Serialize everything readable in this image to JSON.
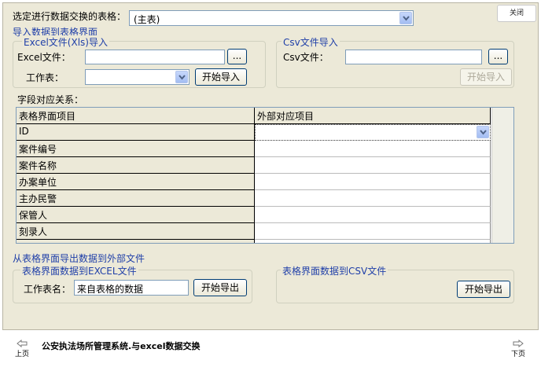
{
  "header": {
    "table_select_label": "选定进行数据交换的表格：",
    "table_select_value": "(主表)",
    "close_label": "关闭"
  },
  "import_section": {
    "title": "导入数据到表格界面",
    "excel_group": {
      "title": "Excel文件(Xls)导入",
      "file_label": "Excel文件：",
      "file_value": "",
      "browse_label": "...",
      "sheet_label": "工作表：",
      "sheet_value": "",
      "start_label": "开始导入"
    },
    "csv_group": {
      "title": "Csv文件导入",
      "file_label": "Csv文件：",
      "file_value": "",
      "browse_label": "...",
      "start_label": "开始导入"
    }
  },
  "mapping": {
    "label": "字段对应关系：",
    "columns": [
      "表格界面项目",
      "外部对应项目"
    ],
    "rows": [
      {
        "field": "ID",
        "external": ""
      },
      {
        "field": "案件编号",
        "external": ""
      },
      {
        "field": "案件名称",
        "external": ""
      },
      {
        "field": "办案单位",
        "external": ""
      },
      {
        "field": "主办民警",
        "external": ""
      },
      {
        "field": "保管人",
        "external": ""
      },
      {
        "field": "刻录人",
        "external": ""
      }
    ]
  },
  "export_section": {
    "title": "从表格界面导出数据到外部文件",
    "excel_group": {
      "title": "表格界面数据到EXCEL文件",
      "sheet_name_label": "工作表名：",
      "sheet_name_value": "来自表格的数据",
      "export_label": "开始导出"
    },
    "csv_group": {
      "title": "表格界面数据到CSV文件",
      "export_label": "开始导出"
    }
  },
  "footer": {
    "caption": "公安执法场所管理系统.与excel数据交换",
    "prev_label": "上页",
    "next_label": "下页"
  }
}
